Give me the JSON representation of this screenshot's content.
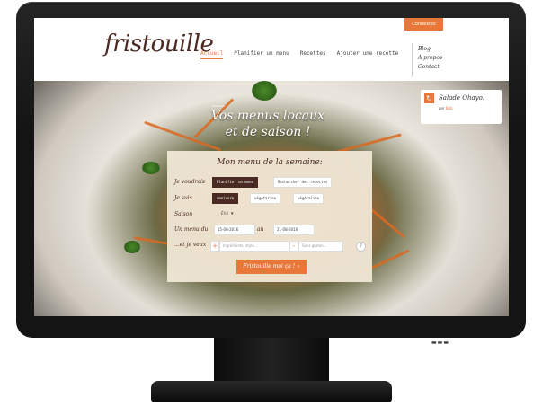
{
  "header": {
    "connexion": "Connexion",
    "logo": "fristouille",
    "nav": [
      "Accueil",
      "Planifier un menu",
      "Recettes",
      "Ajouter une recette"
    ],
    "sidelinks": [
      "Blog",
      "A propos",
      "Contact"
    ]
  },
  "hero": {
    "badge": "fristouille",
    "tagline_line1": "Vos menus locaux",
    "tagline_line2": "et de saison !"
  },
  "recipe_card": {
    "refresh_icon": "refresh-icon",
    "title": "Salade Ohayo!",
    "by_prefix": "par",
    "author": "Bob"
  },
  "form": {
    "title": "Mon menu de la semaine:",
    "want_label": "Je voudrais",
    "want_options": [
      "Planifier un menu",
      "Rechercher des recettes"
    ],
    "diet_label": "Je suis",
    "diet_options": [
      "omnivore",
      "végétarien",
      "végétalien"
    ],
    "season_label": "Saison",
    "season_value": "Été ▼",
    "menu_label": "Un menu du",
    "date_from": "15-08-2016",
    "date_to_label": "au",
    "date_to": "21-08-2016",
    "and_label": "...et je veux",
    "ingredients_placeholder": "Ingrédients, style...",
    "exclude_placeholder": "Sans gluten...",
    "help_text": "?",
    "submit": "Fristouille moi ça !"
  },
  "colors": {
    "accent": "#e8773a",
    "brand_dark": "#4a2a22",
    "panel": "#f0e8d6"
  }
}
